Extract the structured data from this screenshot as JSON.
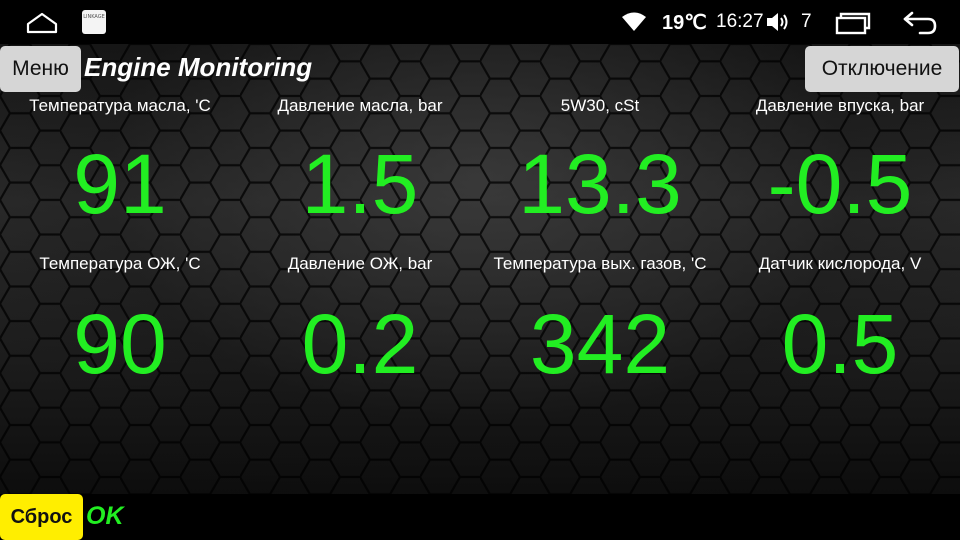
{
  "statusbar": {
    "app_icon_text": "LINKAGE",
    "temperature": "19℃",
    "time": "16:27",
    "volume": "7"
  },
  "header": {
    "menu_label": "Меню",
    "title": "Engine Monitoring",
    "disconnect_label": "Отключение"
  },
  "gauges": [
    {
      "label": "Температура масла, 'C",
      "value": "91"
    },
    {
      "label": "Давление масла, bar",
      "value": "1.5"
    },
    {
      "label": "5W30, cSt",
      "value": "13.3"
    },
    {
      "label": "Давление впуска, bar",
      "value": "-0.5"
    },
    {
      "label": "Температура ОЖ, 'C",
      "value": "90"
    },
    {
      "label": "Давление ОЖ, bar",
      "value": "0.2"
    },
    {
      "label": "Температура вых. газов, 'C",
      "value": "342"
    },
    {
      "label": "Датчик кислорода, V",
      "value": "0.5"
    }
  ],
  "footer": {
    "reset_label": "Сброс",
    "status": "OK"
  },
  "colors": {
    "value_green": "#22ee22",
    "button_gray": "#d6d6d6",
    "reset_yellow": "#ffee00"
  },
  "icons": [
    "home-icon",
    "app-icon",
    "wifi-icon",
    "volume-icon",
    "recent-apps-icon",
    "back-icon"
  ]
}
